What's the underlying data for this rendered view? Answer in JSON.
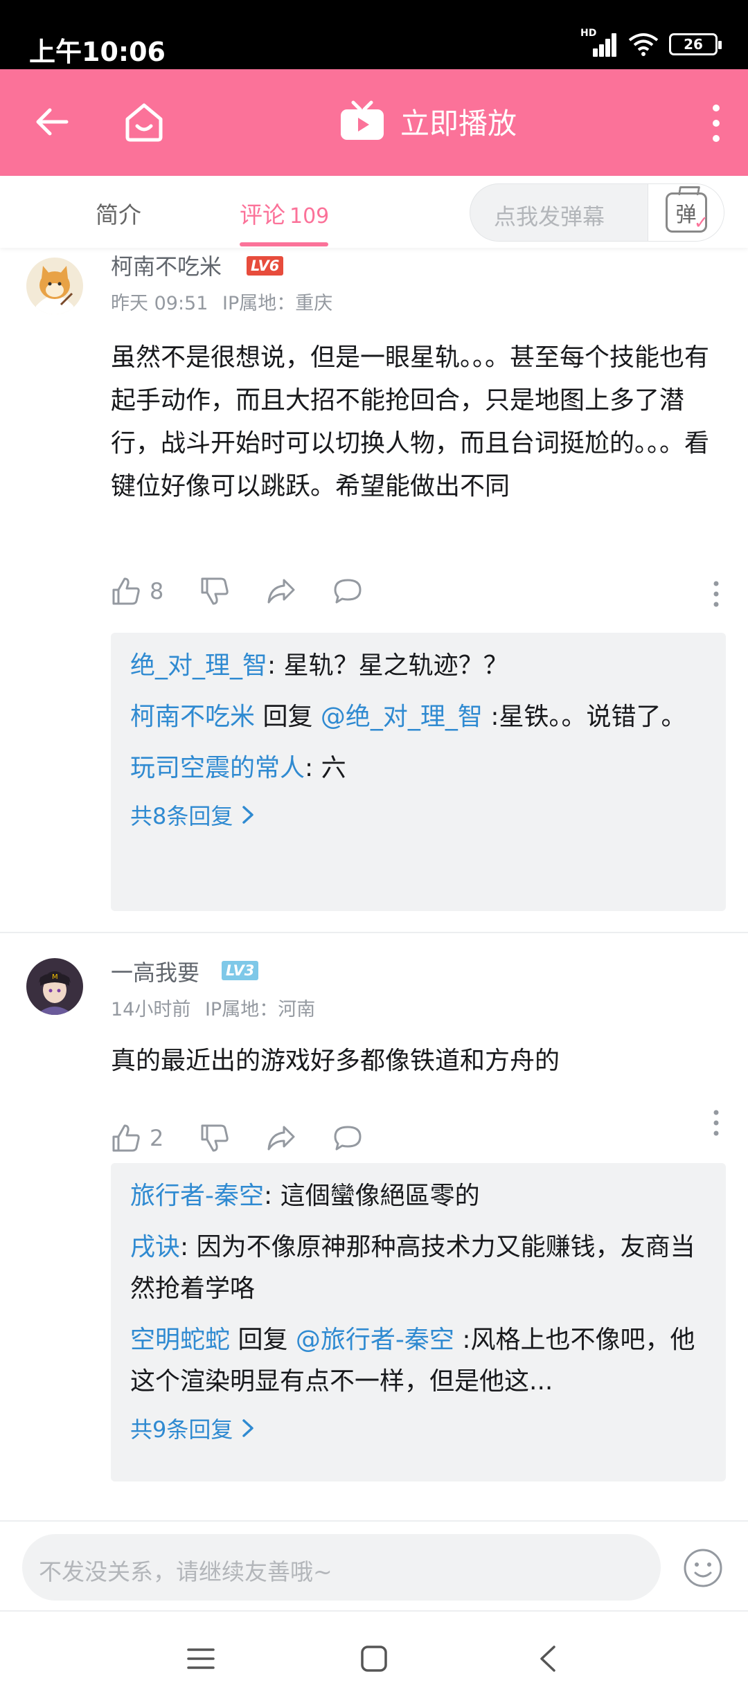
{
  "status_bar": {
    "time": "上午10:06",
    "network": "HD",
    "battery": "26"
  },
  "header": {
    "play_label": "立即播放"
  },
  "tabs": {
    "intro": "简介",
    "comments": "评论",
    "comments_count": "109",
    "danmaku_placeholder": "点我发弹幕",
    "danmaku_icon_text": "弹"
  },
  "comments": [
    {
      "username": "柯南不吃米",
      "level": "LV6",
      "level_color": "#e74c3c",
      "time": "昨天 09:51",
      "ip": "IP属地：重庆",
      "text": "虽然不是很想说，但是一眼星轨。。。甚至每个技能也有起手动作，而且大招不能抢回合，只是地图上多了潜行，战斗开始时可以切换人物，而且台词挺尬的。。。看键位好像可以跳跃。希望能做出不同",
      "likes": "8",
      "replies": [
        {
          "user": "绝_对_理_智",
          "text": ": 星轨？星之轨迹？？"
        },
        {
          "user": "柯南不吃米",
          "reply_word": " 回复 ",
          "target": "@绝_对_理_智",
          "text": " :星铁。。说错了。"
        },
        {
          "user": "玩司空震的常人",
          "text": ": 六"
        }
      ],
      "more_replies": "共8条回复"
    },
    {
      "username": "一高我要",
      "level": "LV3",
      "level_color": "#7ec8e8",
      "time": "14小时前",
      "ip": "IP属地：河南",
      "text": "真的最近出的游戏好多都像铁道和方舟的",
      "likes": "2",
      "replies": [
        {
          "user": "旅行者-秦空",
          "text": ": 這個蠻像絕區零的"
        },
        {
          "user": "戌诀",
          "text": ": 因为不像原神那种高技术力又能赚钱，友商当然抢着学咯"
        },
        {
          "user": "空明蛇蛇",
          "reply_word": " 回复 ",
          "target": "@旅行者-秦空",
          "text": " :风格上也不像吧，他这个渲染明显有点不一样，但是他这..."
        }
      ],
      "more_replies": "共9条回复"
    }
  ],
  "input": {
    "placeholder": "不发没关系，请继续友善哦~"
  },
  "colors": {
    "brand": "#fb7299",
    "link": "#2f8ad1"
  }
}
